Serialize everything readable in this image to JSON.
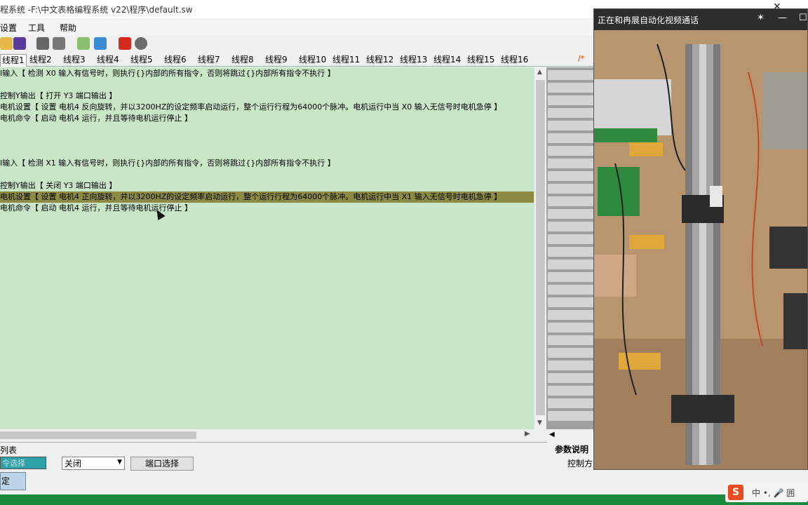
{
  "window": {
    "title": "程系统 -F:\\中文表格编程系统 v22\\程序\\default.sw"
  },
  "menu": {
    "settings": "设置",
    "tools": "工具",
    "help": "帮助"
  },
  "toolbar": {
    "icons": [
      "open-folder-icon",
      "save-icon",
      "gear-icon",
      "camera-icon",
      "cloud-download-icon",
      "telegram-icon",
      "pdf-icon",
      "user-icon"
    ]
  },
  "tabs": [
    "线程1",
    "线程2",
    "线程3",
    "线程4",
    "线程5",
    "线程6",
    "线程7",
    "线程8",
    "线程9",
    "线程10",
    "线程11",
    "线程12",
    "线程13",
    "线程14",
    "线程15",
    "线程16"
  ],
  "tab_extra": "/*",
  "editor": {
    "lines": [
      "I输入【 检测 X0 输入有信号时，则执行{}内部的所有指令，否则将跳过{}内部所有指令不执行 】",
      "",
      "控制Y输出【 打开 Y3 端口输出 】",
      "电机设置【 设置 电机4 反向旋转，并以3200HZ的设定频率启动运行，整个运行行程为64000个脉冲。电机运行中当 X0 输入无信号时电机急停 】",
      "电机命令【 启动 电机4 运行，并且等待电机运行停止 】",
      "",
      "",
      "",
      "I输入【 检测 X1 输入有信号时，则执行{}内部的所有指令，否则将跳过{}内部所有指令不执行 】",
      "",
      "控制Y输出【 关闭 Y3 端口输出 】",
      "电机设置【 设置 电机4 正向旋转，并以3200HZ的设定频率启动运行，整个运行行程为64000个脉冲。电机运行中当 X1 输入无信号时电机急停 】",
      "电机命令【 启动 电机4 运行，并且等待电机运行停止 】"
    ],
    "highlighted_line": 11
  },
  "bottom": {
    "label": "列表",
    "field": "令选择",
    "select_value": "关闭",
    "button": "端口选择",
    "confirm": "定"
  },
  "params": {
    "heading": "参数说明",
    "value": "控制方"
  },
  "video": {
    "title": "正在和冉展自动化视频通话"
  },
  "ime": {
    "logo": "S",
    "text": "中 •, 🎤 囲"
  },
  "colors": {
    "editor_bg": "#c9e6c9",
    "highlight": "#8d8a45",
    "taskbar": "#1b8b3e"
  }
}
